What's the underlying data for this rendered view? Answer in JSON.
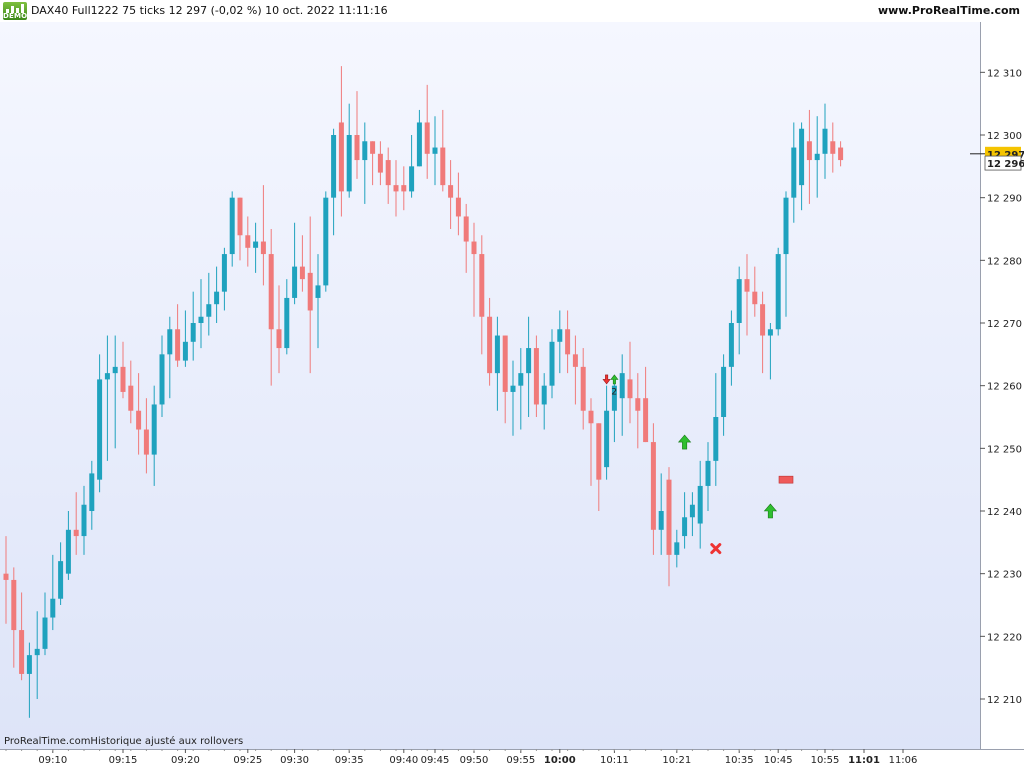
{
  "header": {
    "logo_text": "DEMO",
    "title": "DAX40 Full1222 75 ticks 12 297 (-0,02 %) 10 oct. 2022 11:11:16",
    "brand": "www.ProRealTime.com"
  },
  "footer": {
    "note": "ProRealTime.comHistorique ajusté aux rollovers"
  },
  "colors": {
    "up": "#1fa2be",
    "down": "#f07a7a",
    "current_price_bg": "#f5c400",
    "signal_up": "#2fbf2f",
    "signal_exit": "#ee3333",
    "signal_rect": "#ef5a5a"
  },
  "chart_data": {
    "type": "candlestick",
    "instrument": "DAX40 Full1222",
    "bar_interval": "75 ticks",
    "last_price": "12 297",
    "change": "(-0,02 %)",
    "price_labels": {
      "current": 12297,
      "current_text": "12 297",
      "marker": 12296,
      "marker_text": "12 296"
    },
    "ylim": [
      12203,
      12318
    ],
    "y_ticks": [
      {
        "value": 12210,
        "label": "12 210"
      },
      {
        "value": 12220,
        "label": "12 220"
      },
      {
        "value": 12230,
        "label": "12 230"
      },
      {
        "value": 12240,
        "label": "12 240"
      },
      {
        "value": 12250,
        "label": "12 250"
      },
      {
        "value": 12260,
        "label": "12 260"
      },
      {
        "value": 12270,
        "label": "12 270"
      },
      {
        "value": 12280,
        "label": "12 280"
      },
      {
        "value": 12290,
        "label": "12 290"
      },
      {
        "value": 12300,
        "label": "12 300"
      },
      {
        "value": 12310,
        "label": "12 310"
      }
    ],
    "x_ticks": [
      {
        "bar": 6,
        "label": "09:10",
        "bold": false
      },
      {
        "bar": 15,
        "label": "09:15",
        "bold": false
      },
      {
        "bar": 23,
        "label": "09:20",
        "bold": false
      },
      {
        "bar": 31,
        "label": "09:25",
        "bold": false
      },
      {
        "bar": 37,
        "label": "09:30",
        "bold": false
      },
      {
        "bar": 44,
        "label": "09:35",
        "bold": false
      },
      {
        "bar": 51,
        "label": "09:40",
        "bold": false
      },
      {
        "bar": 55,
        "label": "09:45",
        "bold": false
      },
      {
        "bar": 60,
        "label": "09:50",
        "bold": false
      },
      {
        "bar": 66,
        "label": "09:55",
        "bold": false
      },
      {
        "bar": 71,
        "label": "10:00",
        "bold": true
      },
      {
        "bar": 78,
        "label": "10:11",
        "bold": false
      },
      {
        "bar": 86,
        "label": "10:21",
        "bold": false
      },
      {
        "bar": 94,
        "label": "10:35",
        "bold": false
      },
      {
        "bar": 99,
        "label": "10:45",
        "bold": false
      },
      {
        "bar": 105,
        "label": "10:55",
        "bold": false
      },
      {
        "bar": 110,
        "label": "11:01",
        "bold": true
      },
      {
        "bar": 115,
        "label": "11:06",
        "bold": false
      }
    ],
    "candles": [
      {
        "o": 12230,
        "h": 12236,
        "l": 12222,
        "c": 12229
      },
      {
        "o": 12229,
        "h": 12231,
        "l": 12215,
        "c": 12221
      },
      {
        "o": 12221,
        "h": 12227,
        "l": 12213,
        "c": 12214
      },
      {
        "o": 12214,
        "h": 12219,
        "l": 12207,
        "c": 12217
      },
      {
        "o": 12217,
        "h": 12224,
        "l": 12210,
        "c": 12218
      },
      {
        "o": 12218,
        "h": 12227,
        "l": 12217,
        "c": 12223
      },
      {
        "o": 12223,
        "h": 12233,
        "l": 12221,
        "c": 12226
      },
      {
        "o": 12226,
        "h": 12235,
        "l": 12225,
        "c": 12232
      },
      {
        "o": 12230,
        "h": 12240,
        "l": 12229,
        "c": 12237
      },
      {
        "o": 12237,
        "h": 12243,
        "l": 12233,
        "c": 12236
      },
      {
        "o": 12236,
        "h": 12244,
        "l": 12233,
        "c": 12241
      },
      {
        "o": 12240,
        "h": 12248,
        "l": 12237,
        "c": 12246
      },
      {
        "o": 12245,
        "h": 12265,
        "l": 12243,
        "c": 12261
      },
      {
        "o": 12261,
        "h": 12268,
        "l": 12248,
        "c": 12262
      },
      {
        "o": 12262,
        "h": 12268,
        "l": 12250,
        "c": 12263
      },
      {
        "o": 12263,
        "h": 12267,
        "l": 12258,
        "c": 12259
      },
      {
        "o": 12260,
        "h": 12264,
        "l": 12254,
        "c": 12256
      },
      {
        "o": 12256,
        "h": 12262,
        "l": 12249,
        "c": 12253
      },
      {
        "o": 12253,
        "h": 12258,
        "l": 12246,
        "c": 12249
      },
      {
        "o": 12249,
        "h": 12260,
        "l": 12244,
        "c": 12257
      },
      {
        "o": 12257,
        "h": 12268,
        "l": 12255,
        "c": 12265
      },
      {
        "o": 12265,
        "h": 12271,
        "l": 12258,
        "c": 12269
      },
      {
        "o": 12269,
        "h": 12273,
        "l": 12263,
        "c": 12264
      },
      {
        "o": 12264,
        "h": 12272,
        "l": 12263,
        "c": 12267
      },
      {
        "o": 12267,
        "h": 12275,
        "l": 12264,
        "c": 12270
      },
      {
        "o": 12270,
        "h": 12277,
        "l": 12266,
        "c": 12271
      },
      {
        "o": 12271,
        "h": 12278,
        "l": 12268,
        "c": 12273
      },
      {
        "o": 12273,
        "h": 12279,
        "l": 12270,
        "c": 12275
      },
      {
        "o": 12275,
        "h": 12282,
        "l": 12272,
        "c": 12281
      },
      {
        "o": 12281,
        "h": 12291,
        "l": 12279,
        "c": 12290
      },
      {
        "o": 12290,
        "h": 12288,
        "l": 12280,
        "c": 12284
      },
      {
        "o": 12284,
        "h": 12287,
        "l": 12279,
        "c": 12282
      },
      {
        "o": 12282,
        "h": 12286,
        "l": 12278,
        "c": 12283
      },
      {
        "o": 12283,
        "h": 12292,
        "l": 12276,
        "c": 12281
      },
      {
        "o": 12281,
        "h": 12285,
        "l": 12260,
        "c": 12269
      },
      {
        "o": 12269,
        "h": 12276,
        "l": 12262,
        "c": 12266
      },
      {
        "o": 12266,
        "h": 12277,
        "l": 12265,
        "c": 12274
      },
      {
        "o": 12274,
        "h": 12286,
        "l": 12273,
        "c": 12279
      },
      {
        "o": 12279,
        "h": 12284,
        "l": 12275,
        "c": 12277
      },
      {
        "o": 12278,
        "h": 12287,
        "l": 12262,
        "c": 12272
      },
      {
        "o": 12274,
        "h": 12281,
        "l": 12266,
        "c": 12276
      },
      {
        "o": 12276,
        "h": 12291,
        "l": 12275,
        "c": 12290
      },
      {
        "o": 12290,
        "h": 12301,
        "l": 12284,
        "c": 12300
      },
      {
        "o": 12302,
        "h": 12311,
        "l": 12287,
        "c": 12291
      },
      {
        "o": 12291,
        "h": 12305,
        "l": 12290,
        "c": 12300
      },
      {
        "o": 12300,
        "h": 12307,
        "l": 12293,
        "c": 12296
      },
      {
        "o": 12296,
        "h": 12302,
        "l": 12289,
        "c": 12299
      },
      {
        "o": 12299,
        "h": 12298,
        "l": 12292,
        "c": 12297
      },
      {
        "o": 12297,
        "h": 12299,
        "l": 12292,
        "c": 12294
      },
      {
        "o": 12296,
        "h": 12298,
        "l": 12289,
        "c": 12292
      },
      {
        "o": 12292,
        "h": 12296,
        "l": 12287,
        "c": 12291
      },
      {
        "o": 12292,
        "h": 12295,
        "l": 12288,
        "c": 12291
      },
      {
        "o": 12291,
        "h": 12300,
        "l": 12290,
        "c": 12295
      },
      {
        "o": 12295,
        "h": 12304,
        "l": 12296,
        "c": 12302
      },
      {
        "o": 12302,
        "h": 12308,
        "l": 12293,
        "c": 12297
      },
      {
        "o": 12297,
        "h": 12303,
        "l": 12292,
        "c": 12298
      },
      {
        "o": 12298,
        "h": 12304,
        "l": 12291,
        "c": 12292
      },
      {
        "o": 12292,
        "h": 12296,
        "l": 12285,
        "c": 12290
      },
      {
        "o": 12290,
        "h": 12294,
        "l": 12284,
        "c": 12287
      },
      {
        "o": 12287,
        "h": 12289,
        "l": 12278,
        "c": 12283
      },
      {
        "o": 12283,
        "h": 12286,
        "l": 12271,
        "c": 12281
      },
      {
        "o": 12281,
        "h": 12284,
        "l": 12265,
        "c": 12271
      },
      {
        "o": 12271,
        "h": 12274,
        "l": 12260,
        "c": 12262
      },
      {
        "o": 12262,
        "h": 12271,
        "l": 12256,
        "c": 12268
      },
      {
        "o": 12268,
        "h": 12266,
        "l": 12254,
        "c": 12259
      },
      {
        "o": 12259,
        "h": 12264,
        "l": 12252,
        "c": 12260
      },
      {
        "o": 12260,
        "h": 12266,
        "l": 12253,
        "c": 12262
      },
      {
        "o": 12262,
        "h": 12271,
        "l": 12255,
        "c": 12266
      },
      {
        "o": 12266,
        "h": 12268,
        "l": 12255,
        "c": 12257
      },
      {
        "o": 12257,
        "h": 12262,
        "l": 12253,
        "c": 12260
      },
      {
        "o": 12260,
        "h": 12269,
        "l": 12258,
        "c": 12267
      },
      {
        "o": 12267,
        "h": 12272,
        "l": 12262,
        "c": 12269
      },
      {
        "o": 12269,
        "h": 12272,
        "l": 12262,
        "c": 12265
      },
      {
        "o": 12265,
        "h": 12268,
        "l": 12257,
        "c": 12263
      },
      {
        "o": 12263,
        "h": 12266,
        "l": 12253,
        "c": 12256
      },
      {
        "o": 12256,
        "h": 12258,
        "l": 12244,
        "c": 12254
      },
      {
        "o": 12254,
        "h": 12251,
        "l": 12240,
        "c": 12245
      },
      {
        "o": 12247,
        "h": 12260,
        "l": 12245,
        "c": 12256
      },
      {
        "o": 12256,
        "h": 12261,
        "l": 12251,
        "c": 12260
      },
      {
        "o": 12258,
        "h": 12265,
        "l": 12252,
        "c": 12262
      },
      {
        "o": 12261,
        "h": 12267,
        "l": 12254,
        "c": 12258
      },
      {
        "o": 12258,
        "h": 12262,
        "l": 12250,
        "c": 12256
      },
      {
        "o": 12258,
        "h": 12263,
        "l": 12252,
        "c": 12251
      },
      {
        "o": 12251,
        "h": 12254,
        "l": 12233,
        "c": 12237
      },
      {
        "o": 12237,
        "h": 12246,
        "l": 12233,
        "c": 12240
      },
      {
        "o": 12245,
        "h": 12247,
        "l": 12228,
        "c": 12233
      },
      {
        "o": 12233,
        "h": 12237,
        "l": 12231,
        "c": 12235
      },
      {
        "o": 12236,
        "h": 12243,
        "l": 12234,
        "c": 12239
      },
      {
        "o": 12239,
        "h": 12243,
        "l": 12236,
        "c": 12241
      },
      {
        "o": 12238,
        "h": 12248,
        "l": 12234,
        "c": 12244
      },
      {
        "o": 12244,
        "h": 12251,
        "l": 12240,
        "c": 12248
      },
      {
        "o": 12248,
        "h": 12262,
        "l": 12244,
        "c": 12255
      },
      {
        "o": 12255,
        "h": 12265,
        "l": 12252,
        "c": 12263
      },
      {
        "o": 12263,
        "h": 12272,
        "l": 12260,
        "c": 12270
      },
      {
        "o": 12270,
        "h": 12279,
        "l": 12265,
        "c": 12277
      },
      {
        "o": 12277,
        "h": 12281,
        "l": 12268,
        "c": 12275
      },
      {
        "o": 12275,
        "h": 12279,
        "l": 12271,
        "c": 12273
      },
      {
        "o": 12273,
        "h": 12275,
        "l": 12262,
        "c": 12268
      },
      {
        "o": 12268,
        "h": 12270,
        "l": 12261,
        "c": 12269
      },
      {
        "o": 12269,
        "h": 12282,
        "l": 12268,
        "c": 12281
      },
      {
        "o": 12281,
        "h": 12291,
        "l": 12271,
        "c": 12290
      },
      {
        "o": 12290,
        "h": 12302,
        "l": 12286,
        "c": 12298
      },
      {
        "o": 12292,
        "h": 12302,
        "l": 12288,
        "c": 12301
      },
      {
        "o": 12299,
        "h": 12304,
        "l": 12289,
        "c": 12296
      },
      {
        "o": 12296,
        "h": 12303,
        "l": 12290,
        "c": 12297
      },
      {
        "o": 12297,
        "h": 12305,
        "l": 12293,
        "c": 12301
      },
      {
        "o": 12299,
        "h": 12302,
        "l": 12294,
        "c": 12297
      },
      {
        "o": 12298,
        "h": 12299,
        "l": 12295,
        "c": 12296
      }
    ],
    "signals": [
      {
        "type": "down-arrow",
        "bar": 77,
        "price": 12261
      },
      {
        "type": "up-arrow",
        "bar": 78,
        "price": 12261,
        "label": "2"
      },
      {
        "type": "up-arrow",
        "bar": 87,
        "price": 12251
      },
      {
        "type": "exit-cross",
        "bar": 91,
        "price": 12234
      },
      {
        "type": "up-arrow",
        "bar": 98,
        "price": 12240
      },
      {
        "type": "level-rect",
        "bar": 100,
        "price": 12245
      }
    ]
  }
}
